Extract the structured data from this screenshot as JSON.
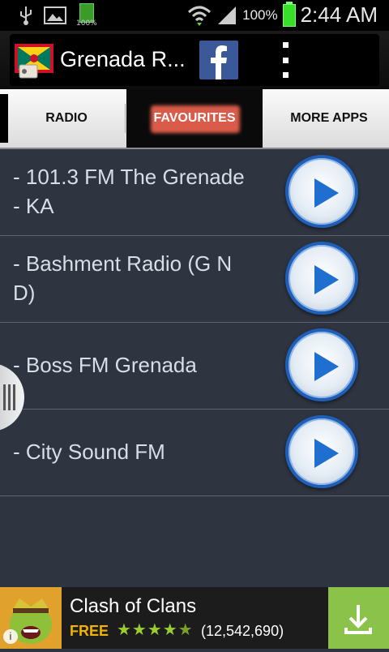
{
  "status_bar": {
    "battery_text": "100%",
    "time": "2:44 AM",
    "mini_battery_label": "100%"
  },
  "app_bar": {
    "title": "Grenada R...",
    "flag_colors": {
      "red": "#ce1126",
      "yellow": "#fcd116",
      "green": "#007a5e"
    },
    "facebook_color": "#3b5998"
  },
  "tabs": [
    {
      "label": "RADIO",
      "active": false
    },
    {
      "label": "FAVOURITES",
      "active": true
    },
    {
      "label": "MORE APPS",
      "active": false
    }
  ],
  "stations": [
    {
      "name": "- 101.3 FM The Grenade - KA"
    },
    {
      "name": "- Bashment Radio (G N D)"
    },
    {
      "name": "- Boss FM Grenada"
    },
    {
      "name": "- City Sound FM"
    }
  ],
  "ad": {
    "title": "Clash of Clans",
    "price": "FREE",
    "rating_stars": 4.5,
    "rating_count": "(12,542,690)",
    "download_color": "#8bc34a"
  }
}
